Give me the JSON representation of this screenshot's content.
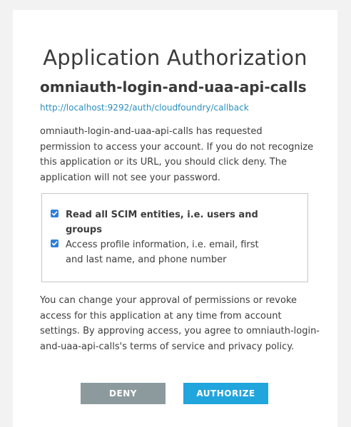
{
  "page": {
    "title": "Application Authorization"
  },
  "client": {
    "name": "omniauth-login-and-uaa-api-calls",
    "redirect_uri": "http://localhost:9292/auth/cloudfoundry/callback"
  },
  "request_text": "omniauth-login-and-uaa-api-calls has requested permission to access your account. If you do not recognize this application or its URL, you should click deny. The application will not see your password.",
  "scopes": [
    {
      "label": "Read all SCIM entities, i.e. users and groups",
      "checked": true
    },
    {
      "label": "Access profile information, i.e. email, first and last name, and phone number",
      "checked": true
    }
  ],
  "footer_text": "You can change your approval of permissions or revoke access for this application at any time from account settings. By approving access, you agree to omniauth-login-and-uaa-api-calls's terms of service and privacy policy.",
  "buttons": {
    "deny_label": "DENY",
    "authorize_label": "AUTHORIZE"
  },
  "colors": {
    "checkbox": "#2f7fd8",
    "deny": "#8c9a9e",
    "authorize": "#21a5dd",
    "link": "#2a8fbd"
  },
  "icons": {
    "checkbox": "checkmark-icon"
  }
}
